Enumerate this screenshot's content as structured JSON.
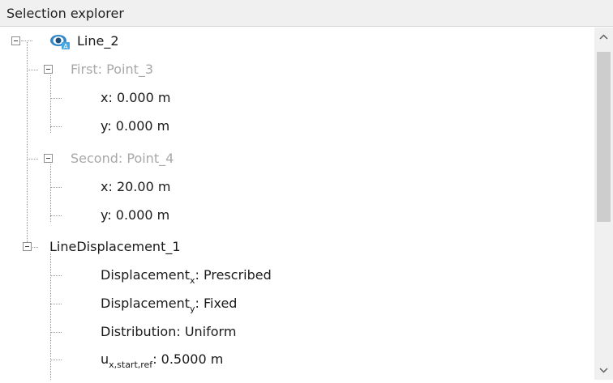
{
  "panel": {
    "title": "Selection explorer"
  },
  "tree": {
    "root": {
      "label": "Line_2"
    },
    "first": {
      "label": "First: Point_3",
      "x": "x: 0.000 m",
      "y": "y: 0.000 m"
    },
    "second": {
      "label": "Second: Point_4",
      "x": "x: 20.00 m",
      "y": "y: 0.000 m"
    },
    "displacement": {
      "label": "LineDisplacement_1",
      "items": [
        {
          "main": "Displacement",
          "sub": "x",
          "rest": ": Prescribed"
        },
        {
          "main": "Displacement",
          "sub": "y",
          "rest": ": Fixed"
        },
        {
          "main": "Distribution: Uniform",
          "sub": "",
          "rest": ""
        },
        {
          "main": "u",
          "sub": "x,start,ref",
          "rest": ": 0.5000 m"
        }
      ]
    }
  },
  "icons": {
    "root_icon": "eye-icon",
    "expander": "collapse-box-icon",
    "scroll_up": "chevron-up-icon",
    "scroll_down": "chevron-down-icon"
  },
  "colors": {
    "accent": "#2f86c8",
    "disabled_text": "#a8a8a8"
  }
}
